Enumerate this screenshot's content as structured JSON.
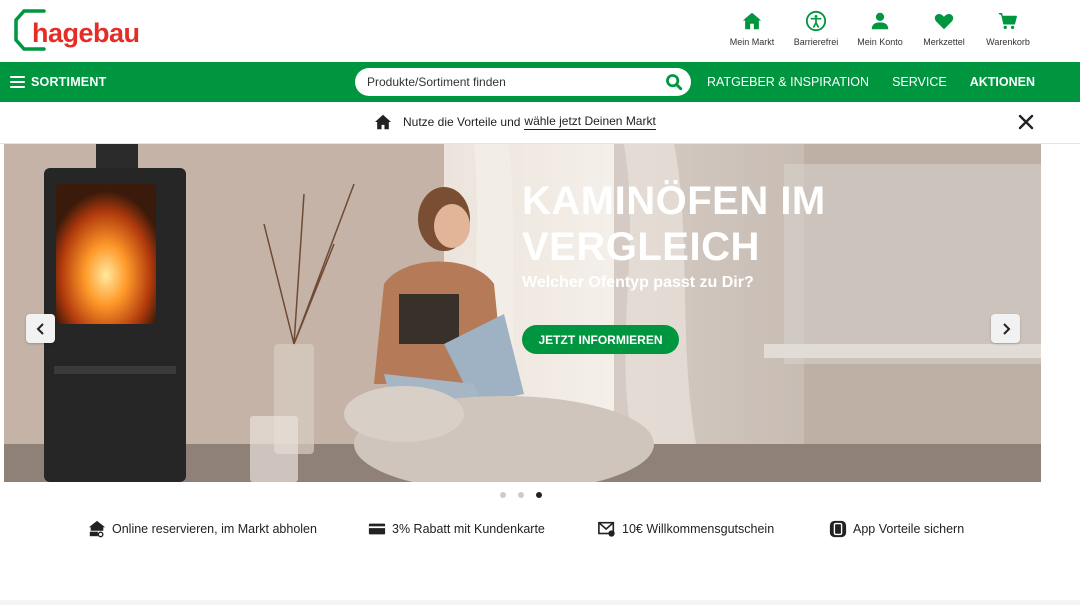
{
  "brand": {
    "name": "hagebau",
    "color": "#e52d27",
    "accent": "#009640"
  },
  "top_icons": [
    {
      "icon": "home-icon",
      "label": "Mein Markt"
    },
    {
      "icon": "accessibility-icon",
      "label": "Barrierefrei"
    },
    {
      "icon": "user-icon",
      "label": "Mein Konto"
    },
    {
      "icon": "heart-icon",
      "label": "Merkzettel"
    },
    {
      "icon": "cart-icon",
      "label": "Warenkorb"
    }
  ],
  "nav": {
    "sortiment_label": "SORTIMENT",
    "search_placeholder": "Produkte/Sortiment finden",
    "links": [
      "RATGEBER & INSPIRATION",
      "SERVICE",
      "AKTIONEN"
    ]
  },
  "info_strip": {
    "text": "Nutze die Vorteile und",
    "link_text": "wähle jetzt Deinen Markt"
  },
  "hero": {
    "title_line1": "KAMINÖFEN IM",
    "title_line2": "VERGLEICH",
    "subtitle": "Welcher Ofentyp passt zu Dir?",
    "cta": "JETZT INFORMIEREN",
    "slides_count": 3,
    "active_slide": 3
  },
  "usps": [
    {
      "icon": "store-pickup-icon",
      "label": "Online reservieren, im Markt abholen"
    },
    {
      "icon": "card-icon",
      "label": "3% Rabatt mit Kundenkarte"
    },
    {
      "icon": "mail-voucher-icon",
      "label": "10€ Willkommensgutschein"
    },
    {
      "icon": "app-icon",
      "label": "App Vorteile sichern"
    }
  ]
}
